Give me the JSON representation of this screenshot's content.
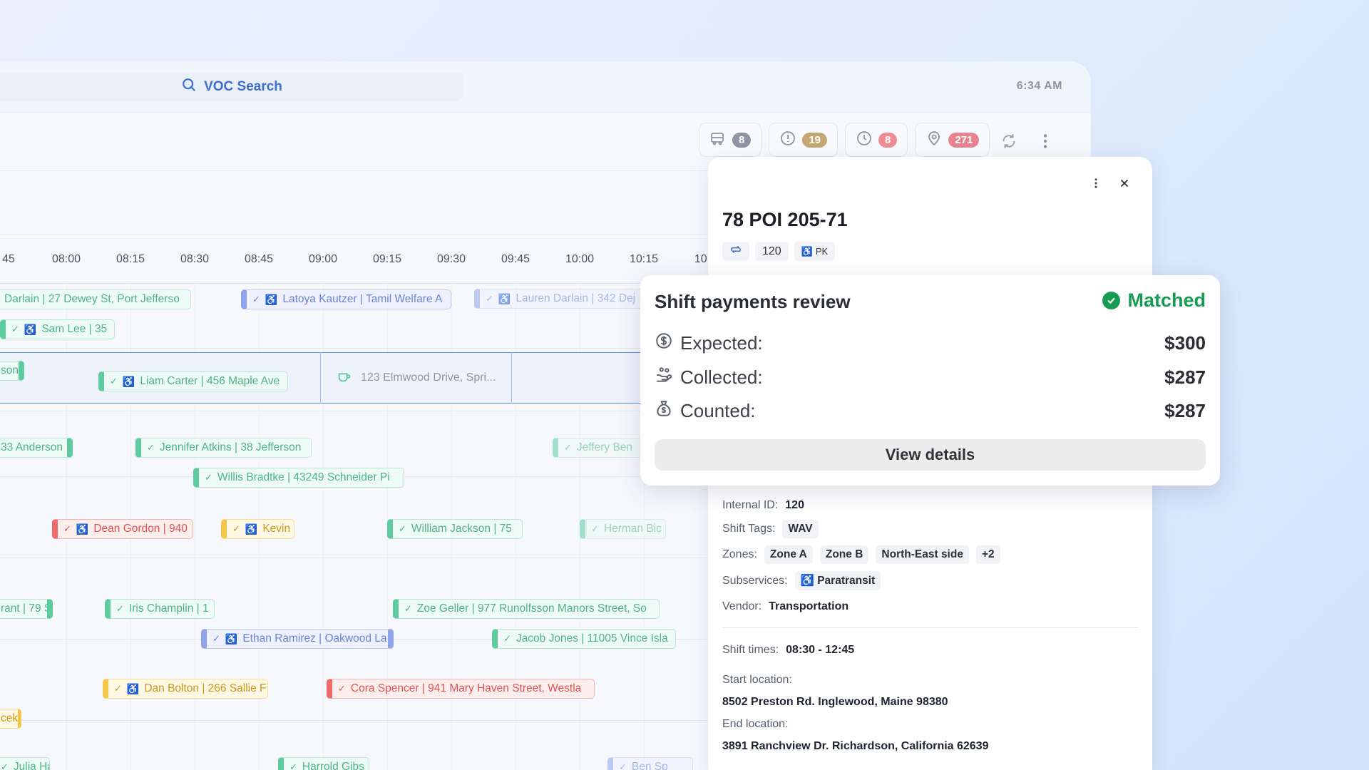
{
  "search": {
    "label": "VOC Search"
  },
  "clock": "6:34 AM",
  "toolbar": {
    "stats": [
      {
        "icon": "bus-icon",
        "count": "8",
        "color": "#8d95a3"
      },
      {
        "icon": "alert-icon",
        "count": "19",
        "color": "#c5a773"
      },
      {
        "icon": "clock-icon",
        "count": "8",
        "color": "#ef8d92"
      },
      {
        "icon": "location-icon",
        "count": "271",
        "color": "#e8848f"
      }
    ]
  },
  "timescale": [
    "45",
    "08:00",
    "08:15",
    "08:30",
    "08:45",
    "09:00",
    "09:15",
    "09:30",
    "09:45",
    "10:00",
    "10:15",
    "10:"
  ],
  "timeline": {
    "break_block": "123 Elmwood Drive, Spri...",
    "chips": [
      "Darlain | 27 Dewey St, Port Jefferso",
      "Latoya Kautzer | Tamil Welfare A",
      "Lauren Darlain | 342 Dej",
      "Sam Lee | 35",
      "son (",
      "Liam Carter | 456 Maple Ave",
      "33 Anderson",
      "Jennifer Atkins | 38 Jefferson",
      "Jeffery Ben",
      "Willis Bradtke | 43249 Schneider Pi",
      "Dean Gordon | 940",
      "Kevin",
      "William Jackson | 75",
      "Herman Bic",
      "rant | 79 S",
      "Iris Champlin | 1",
      "Zoe Geller | 977 Runolfsson Manors Street, So",
      "Ethan Ramirez | Oakwood La",
      "Jacob Jones | 11005 Vince Isla",
      "Dan Bolton | 266 Sallie F",
      "Cora Spencer | 941 Mary Haven Street, Westla",
      "cek",
      "Julia Ha",
      "Harrold Gibs",
      "Ben Sp"
    ]
  },
  "panel": {
    "vehicle_id": "78 POI 205-71",
    "tags": [
      "120",
      "PK"
    ],
    "internal_id_label": "Internal ID:",
    "internal_id": "120",
    "shift_tags_label": "Shift Tags:",
    "shift_tags": [
      "WAV"
    ],
    "zones_label": "Zones:",
    "zones": [
      "Zone A",
      "Zone B",
      "North-East side",
      "+2"
    ],
    "subservices_label": "Subservices:",
    "subservice": "Paratransit",
    "vendor_label": "Vendor:",
    "vendor": "Transportation",
    "shift_times_label": "Shift times:",
    "shift_times": "08:30 - 12:45",
    "start_location_label": "Start location:",
    "start_location": "8502 Preston Rd. Inglewood, Maine 98380",
    "end_location_label": "End location:",
    "end_location": "3891 Ranchview Dr. Richardson, California 62639"
  },
  "payments": {
    "title": "Shift payments review",
    "status": "Matched",
    "status_color": "#169b54",
    "rows": [
      {
        "label": "Expected:",
        "value": "$300",
        "icon": "dollar-icon"
      },
      {
        "label": "Collected:",
        "value": "$287",
        "icon": "hand-coins-icon"
      },
      {
        "label": "Counted:",
        "value": "$287",
        "icon": "money-bag-icon"
      }
    ],
    "button": "View details"
  }
}
